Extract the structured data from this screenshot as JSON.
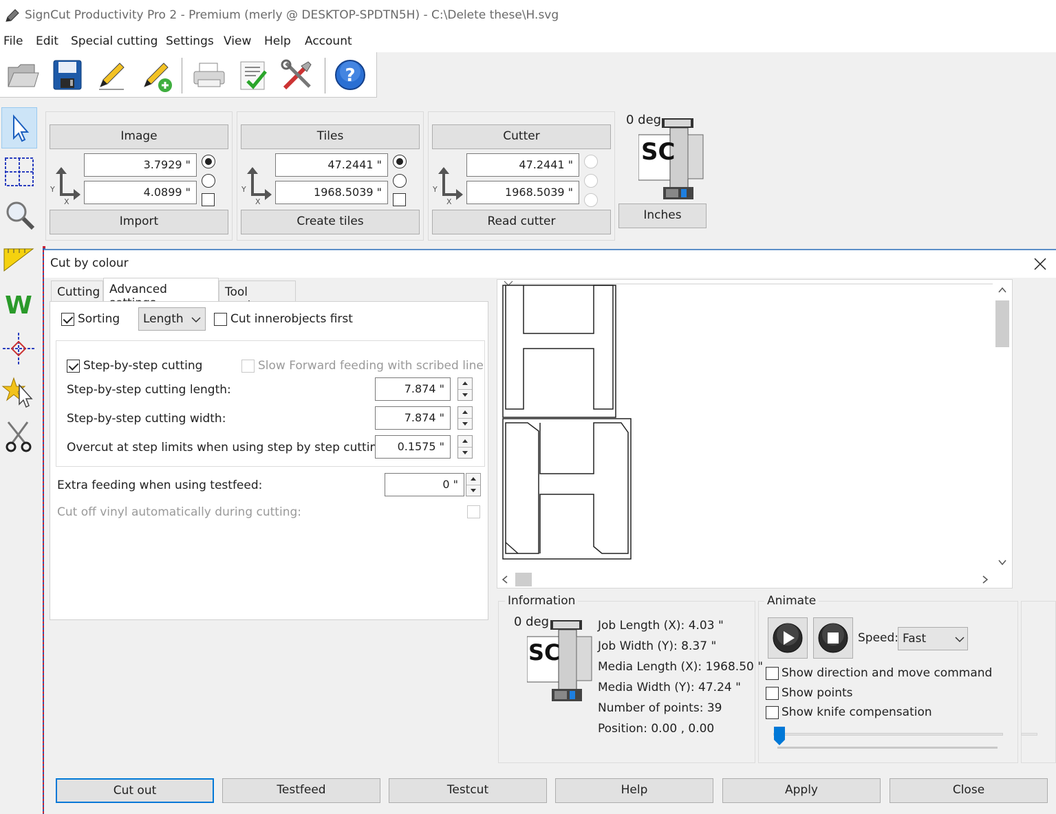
{
  "window": {
    "title": "SignCut Productivity Pro 2 - Premium (merly @ DESKTOP-SPDTN5H)  - C:\\Delete these\\H.svg"
  },
  "menu": [
    "File",
    "Edit",
    "Special cutting",
    "Settings",
    "View",
    "Help",
    "Account"
  ],
  "toolbar_icons": [
    "open-folder-icon",
    "save-icon",
    "pen-icon",
    "pen-add-icon",
    "printer-icon",
    "checklist-icon",
    "tools-icon",
    "help-icon"
  ],
  "left_tools": [
    "pointer-icon",
    "grid-select-icon",
    "zoom-icon",
    "ruler-icon",
    "weed-icon",
    "registration-mark-icon",
    "star-cursor-icon",
    "scissors-icon"
  ],
  "image_group": {
    "header": "Image",
    "x_value": "3.7929 \"",
    "y_value": "4.0899 \"",
    "button": "Import"
  },
  "tiles_group": {
    "header": "Tiles",
    "x_value": "47.2441 \"",
    "y_value": "1968.5039 \"",
    "button": "Create tiles"
  },
  "cutter_group": {
    "header": "Cutter",
    "x_value": "47.2441 \"",
    "y_value": "1968.5039 \"",
    "button": "Read cutter"
  },
  "axis": {
    "x": "X",
    "y": "Y"
  },
  "rotation": {
    "label": "0 deg",
    "units_button": "Inches",
    "logo_text": "SC"
  },
  "dialog": {
    "title": "Cut by colour",
    "tabs": [
      "Cutting",
      "Advanced settings",
      "Tool settings"
    ],
    "active_tab": "Advanced settings",
    "sorting_label": "Sorting",
    "sorting_checked": true,
    "sorting_select": "Length",
    "cut_inner_first": "Cut innerobjects first",
    "step_by_step": "Step-by-step cutting",
    "slow_forward": "Slow Forward feeding with scribed line",
    "step_length_label": "Step-by-step cutting length:",
    "step_length_value": "7.874 \"",
    "step_width_label": "Step-by-step cutting width:",
    "step_width_value": "7.874 \"",
    "overcut_label": "Overcut at step limits when using step by step cutting:",
    "overcut_value": "0.1575 \"",
    "extra_feed_label": "Extra feeding when using testfeed:",
    "extra_feed_value": "0 \"",
    "cut_off_vinyl_label": "Cut off vinyl automatically during cutting:"
  },
  "information": {
    "title": "Information",
    "deg": "0 deg",
    "lines": [
      "Job Length (X): 4.03 \"",
      "Job Width (Y): 8.37 \"",
      "Media Length (X): 1968.50 \"",
      "Media Width (Y): 47.24 \"",
      "Number of points: 39",
      "Position: 0.00 , 0.00"
    ]
  },
  "animate": {
    "title": "Animate",
    "speed_label": "Speed:",
    "speed_value": "Fast",
    "options": [
      "Show direction and move command",
      "Show points",
      "Show knife compensation"
    ],
    "slider_position": 0.0
  },
  "buttons": [
    "Cut out",
    "Testfeed",
    "Testcut",
    "Help",
    "Apply",
    "Close"
  ]
}
